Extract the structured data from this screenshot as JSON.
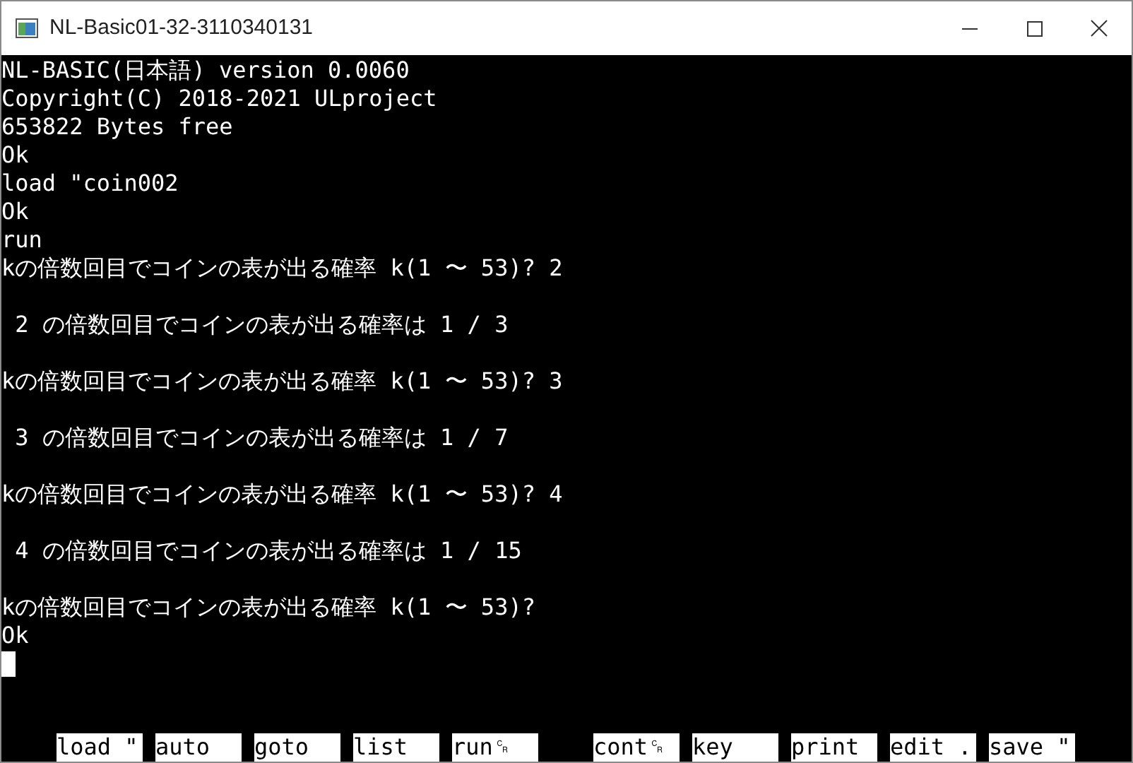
{
  "window": {
    "title": "NL-Basic01-32-3110340131"
  },
  "console": {
    "lines": [
      {
        "kind": "text",
        "text": "NL-BASIC(日本語) version 0.0060"
      },
      {
        "kind": "text",
        "text": "Copyright(C) 2018-2021 ULproject"
      },
      {
        "kind": "text",
        "text": "653822 Bytes free"
      },
      {
        "kind": "text",
        "text": "Ok"
      },
      {
        "kind": "text",
        "text": "load \"coin002"
      },
      {
        "kind": "text",
        "text": "Ok"
      },
      {
        "kind": "text",
        "text": "run"
      },
      {
        "kind": "text",
        "text": "kの倍数回目でコインの表が出る確率 k(1 〜 53)? 2"
      },
      {
        "kind": "blank"
      },
      {
        "kind": "text",
        "text": " 2 の倍数回目でコインの表が出る確率は 1 / 3"
      },
      {
        "kind": "blank"
      },
      {
        "kind": "text",
        "text": "kの倍数回目でコインの表が出る確率 k(1 〜 53)? 3"
      },
      {
        "kind": "blank"
      },
      {
        "kind": "text",
        "text": " 3 の倍数回目でコインの表が出る確率は 1 / 7"
      },
      {
        "kind": "blank"
      },
      {
        "kind": "text",
        "text": "kの倍数回目でコインの表が出る確率 k(1 〜 53)? 4"
      },
      {
        "kind": "blank"
      },
      {
        "kind": "text",
        "text": " 4 の倍数回目でコインの表が出る確率は 1 / 15"
      },
      {
        "kind": "blank"
      },
      {
        "kind": "text",
        "text": "kの倍数回目でコインの表が出る確率 k(1 〜 53)?"
      },
      {
        "kind": "text",
        "text": "Ok"
      }
    ],
    "cursor_visible": true
  },
  "function_keys": [
    {
      "kind": "key",
      "label": "load \""
    },
    {
      "kind": "key",
      "label": "auto"
    },
    {
      "kind": "key",
      "label": "goto"
    },
    {
      "kind": "key",
      "label": "list"
    },
    {
      "kind": "key",
      "label": "run␍"
    },
    {
      "kind": "empty"
    },
    {
      "kind": "key",
      "label": "cont␍"
    },
    {
      "kind": "key",
      "label": "key"
    },
    {
      "kind": "key",
      "label": "print"
    },
    {
      "kind": "key",
      "label": "edit ."
    },
    {
      "kind": "key",
      "label": "save \""
    }
  ]
}
